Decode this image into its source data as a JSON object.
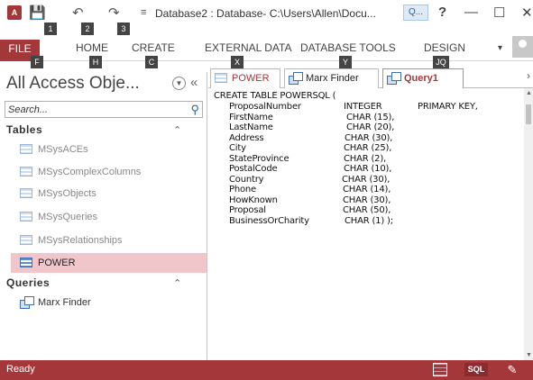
{
  "titlebar": {
    "app_icon": "A",
    "title": "Database2 : Database- C:\\Users\\Allen\\Docu...",
    "search_label": "Q...",
    "help": "?",
    "minimize": "—",
    "restore": "☐",
    "close": "✕",
    "keytips": [
      "1",
      "2",
      "3"
    ]
  },
  "ribbon": {
    "tabs": [
      {
        "label": "FILE",
        "key": "F"
      },
      {
        "label": "HOME",
        "key": "H"
      },
      {
        "label": "CREATE",
        "key": "C"
      },
      {
        "label": "EXTERNAL DATA",
        "key": "X"
      },
      {
        "label": "DATABASE TOOLS",
        "key": "Y"
      },
      {
        "label": "DESIGN",
        "key": "JQ"
      }
    ]
  },
  "nav": {
    "title": "All Access Obje...",
    "search_placeholder": "Search...",
    "tables_header": "Tables",
    "tables": [
      {
        "label": "MSysACEs"
      },
      {
        "label": "MSysComplexColumns"
      },
      {
        "label": "MSysObjects"
      },
      {
        "label": "MSysQueries"
      },
      {
        "label": "MSysRelationships"
      },
      {
        "label": "POWER"
      }
    ],
    "queries_header": "Queries",
    "queries": [
      {
        "label": "Marx Finder"
      }
    ]
  },
  "doc_tabs": [
    {
      "label": "POWER"
    },
    {
      "label": "Marx Finder"
    },
    {
      "label": "Query1"
    }
  ],
  "sql": {
    "header": "CREATE TABLE POWERSQL (",
    "columns": [
      {
        "name": "ProposalNumber",
        "type": "INTEGER",
        "extra": "PRIMARY KEY,"
      },
      {
        "name": "FirstName",
        "type": "CHAR (15),"
      },
      {
        "name": "LastName",
        "type": "CHAR (20),"
      },
      {
        "name": "Address",
        "type": "CHAR (30),"
      },
      {
        "name": "City",
        "type": "CHAR (25),"
      },
      {
        "name": "StateProvince",
        "type": "CHAR (2),"
      },
      {
        "name": "PostalCode",
        "type": "CHAR (10),"
      },
      {
        "name": "Country",
        "type": "CHAR (30),"
      },
      {
        "name": "Phone",
        "type": "CHAR (14),"
      },
      {
        "name": "HowKnown",
        "type": "CHAR (30),"
      },
      {
        "name": "Proposal",
        "type": "CHAR (50),"
      },
      {
        "name": "BusinessOrCharity",
        "type": "CHAR (1) );"
      }
    ]
  },
  "status": {
    "text": "Ready",
    "sql_label": "SQL"
  }
}
